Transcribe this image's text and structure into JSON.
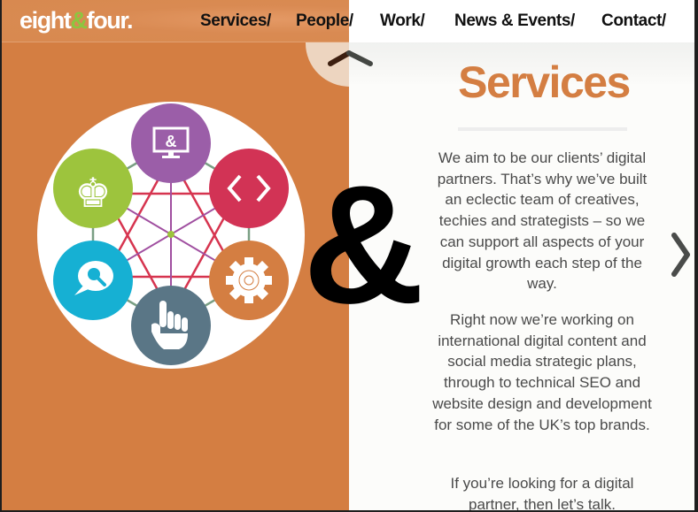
{
  "brand": {
    "logo_part1": "eight",
    "logo_amp": "&",
    "logo_part2": "four.",
    "colors": {
      "orange": "#d47e42",
      "green": "#8cc63f",
      "purple": "#9b5ea8",
      "crimson": "#d23355",
      "cyan": "#16b0d3",
      "slate": "#5a7686",
      "white": "#ffffff",
      "text": "#4a4a4a"
    }
  },
  "nav": {
    "items": [
      {
        "label": "Services/"
      },
      {
        "label": "People/"
      },
      {
        "label": "Work/"
      },
      {
        "label": "News & Events/"
      },
      {
        "label": "Contact/"
      }
    ]
  },
  "hero": {
    "ampersand": "&",
    "diagram_icons": [
      {
        "name": "monitor-ampersand-icon",
        "glyph": "&",
        "color": "#9b5ea8"
      },
      {
        "name": "code-brackets-icon",
        "glyph": "< >",
        "color": "#d23355"
      },
      {
        "name": "gear-icon",
        "color": "#d47e42"
      },
      {
        "name": "pointing-hand-icon",
        "color": "#5a7686"
      },
      {
        "name": "speech-search-icon",
        "color": "#16b0d3"
      },
      {
        "name": "chess-king-icon",
        "glyph": "♚",
        "color": "#9dc43d"
      }
    ]
  },
  "content": {
    "title": "Services",
    "paragraphs": [
      "We aim to be our clients’ digital partners. That’s why we’ve built an eclectic team of creatives, techies and strategists – so we can support all aspects of your digital growth each step of the way.",
      "Right now we’re working on international digital content and social media strategic plans, through to technical SEO and website design and development for some of the UK’s top brands.",
      "If you’re looking for a digital partner, then let’s talk."
    ]
  },
  "controls": {
    "prev_icon": "chevron-up-icon",
    "next_icon": "chevron-right-icon"
  }
}
